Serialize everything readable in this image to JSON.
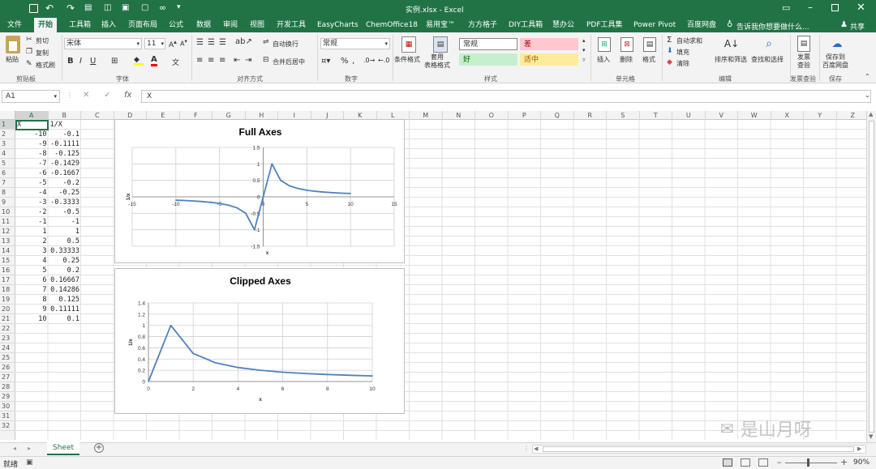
{
  "title": "实例.xlsx - Excel",
  "colors": {
    "brand": "#217346",
    "series": "#4f81bd"
  },
  "tabs": [
    "文件",
    "开始",
    "工具箱",
    "插入",
    "页面布局",
    "公式",
    "数据",
    "审阅",
    "视图",
    "开发工具",
    "EasyCharts",
    "ChemOffice18",
    "易用宝™",
    "方方格子",
    "DIY工具箱",
    "慧办公",
    "PDF工具集",
    "Power Pivot",
    "百度网盘"
  ],
  "tell_me": "告诉我你想要做什么...",
  "share": "共享",
  "ribbon": {
    "paste": "粘贴",
    "cut": "剪切",
    "copy": "复制",
    "format_painter": "格式刷",
    "clipboard": "剪贴板",
    "font_name": "宋体",
    "font_size": "11",
    "font_group": "字体",
    "wrap": "自动换行",
    "merge": "合并后居中",
    "align_group": "对齐方式",
    "number_format": "常规",
    "number_group": "数字",
    "cond_format": "条件格式",
    "table_format": "套用\n表格格式",
    "style_normal": "常规",
    "style_bad": "差",
    "style_good": "好",
    "style_neutral": "适中",
    "styles_group": "样式",
    "insert": "插入",
    "delete": "删除",
    "format": "格式",
    "cells_group": "单元格",
    "autosum": "自动求和",
    "fill": "填充",
    "clear": "清除",
    "sort_filter": "排序和筛选",
    "find_select": "查找和选择",
    "edit_group": "编辑",
    "invoice_check": "发票\n查验",
    "invoice_group": "发票查验",
    "save_baidu": "保存到\n百度网盘",
    "save_group": "保存"
  },
  "namebox": "A1",
  "formula": "X",
  "columns": [
    "A",
    "B",
    "C",
    "D",
    "E",
    "F",
    "G",
    "H",
    "I",
    "J",
    "K",
    "L",
    "M",
    "N",
    "O",
    "P",
    "Q",
    "R",
    "S",
    "T",
    "U",
    "V",
    "W",
    "X",
    "Y",
    "Z"
  ],
  "rows": [
    "1",
    "2",
    "3",
    "4",
    "5",
    "6",
    "7",
    "8",
    "9",
    "10",
    "11",
    "12",
    "13",
    "14",
    "15",
    "16",
    "17",
    "18",
    "19",
    "20",
    "21",
    "22",
    "23",
    "24",
    "25",
    "26",
    "27",
    "28",
    "29",
    "30",
    "31",
    "32"
  ],
  "table": {
    "headers": [
      "X",
      "1/X"
    ],
    "rows": [
      [
        "-10",
        "-0.1"
      ],
      [
        "-9",
        "-0.1111"
      ],
      [
        "-8",
        "-0.125"
      ],
      [
        "-7",
        "-0.1429"
      ],
      [
        "-6",
        "-0.1667"
      ],
      [
        "-5",
        "-0.2"
      ],
      [
        "-4",
        "-0.25"
      ],
      [
        "-3",
        "-0.3333"
      ],
      [
        "-2",
        "-0.5"
      ],
      [
        "-1",
        "-1"
      ],
      [
        "1",
        "1"
      ],
      [
        "2",
        "0.5"
      ],
      [
        "3",
        "0.33333"
      ],
      [
        "4",
        "0.25"
      ],
      [
        "5",
        "0.2"
      ],
      [
        "6",
        "0.16667"
      ],
      [
        "7",
        "0.14286"
      ],
      [
        "8",
        "0.125"
      ],
      [
        "9",
        "0.11111"
      ],
      [
        "10",
        "0.1"
      ]
    ]
  },
  "chart_data": [
    {
      "type": "line",
      "title": "Full Axes",
      "xlabel": "x",
      "ylabel": "1/x",
      "xlim": [
        -15,
        15
      ],
      "ylim": [
        -1.5,
        1.5
      ],
      "xticks": [
        "-15",
        "-10",
        "-5",
        "0",
        "5",
        "10",
        "15"
      ],
      "yticks": [
        "1.5",
        "1",
        "0.5",
        "0",
        "-0.5",
        "-1",
        "-1.5"
      ],
      "grid": true,
      "x": [
        -10,
        -9,
        -8,
        -7,
        -6,
        -5,
        -4,
        -3,
        -2,
        -1,
        1,
        2,
        3,
        4,
        5,
        6,
        7,
        8,
        9,
        10
      ],
      "y": [
        -0.1,
        -0.1111,
        -0.125,
        -0.1429,
        -0.1667,
        -0.2,
        -0.25,
        -0.3333,
        -0.5,
        -1,
        1,
        0.5,
        0.33333,
        0.25,
        0.2,
        0.16667,
        0.14286,
        0.125,
        0.11111,
        0.1
      ]
    },
    {
      "type": "line",
      "title": "Clipped Axes",
      "xlabel": "x",
      "ylabel": "1/x",
      "xlim": [
        0,
        10
      ],
      "ylim": [
        0,
        1.4
      ],
      "xticks": [
        "0",
        "2",
        "4",
        "6",
        "8",
        "10"
      ],
      "yticks": [
        "1.4",
        "1.2",
        "1",
        "0.8",
        "0.6",
        "0.4",
        "0.2",
        "0"
      ],
      "grid": true,
      "x": [
        0,
        1,
        2,
        3,
        4,
        5,
        6,
        7,
        8,
        9,
        10
      ],
      "y": [
        0,
        1,
        0.5,
        0.33333,
        0.25,
        0.2,
        0.16667,
        0.14286,
        0.125,
        0.11111,
        0.1
      ]
    }
  ],
  "sheet_tab": "Sheet",
  "status": "就绪",
  "zoom": "90%",
  "watermark": "是山月呀"
}
